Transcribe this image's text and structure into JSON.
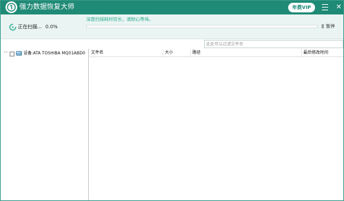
{
  "app": {
    "title": "强力数据恢复大师",
    "vip_label": "年费VIP",
    "close_glyph": "✕"
  },
  "scan": {
    "status_label": "正在扫描...",
    "percent": "0.0%",
    "progress_fraction": 0.0,
    "hint": "深度扫描耗时较长，请耐心等待。",
    "pause_glyph": "||",
    "pause_label": "暂停"
  },
  "filter": {
    "placeholder": "此处可以过滤文件名",
    "value": ""
  },
  "tree": {
    "device_label": "设备:ATA TOSHIBA MQ01ABD0"
  },
  "table": {
    "columns": [
      "文件名",
      "大小",
      "路径",
      "最后修改时间"
    ],
    "rows": []
  },
  "colors": {
    "brand": "#1f8a76",
    "accent_text": "#2eaa8f",
    "panel_bg": "#eaf5f3"
  },
  "icons": {
    "logo": "logo-icon",
    "menu": "hamburger-menu-icon",
    "close": "close-icon",
    "scan": "scanning-spinner-icon",
    "device": "hard-drive-icon"
  }
}
